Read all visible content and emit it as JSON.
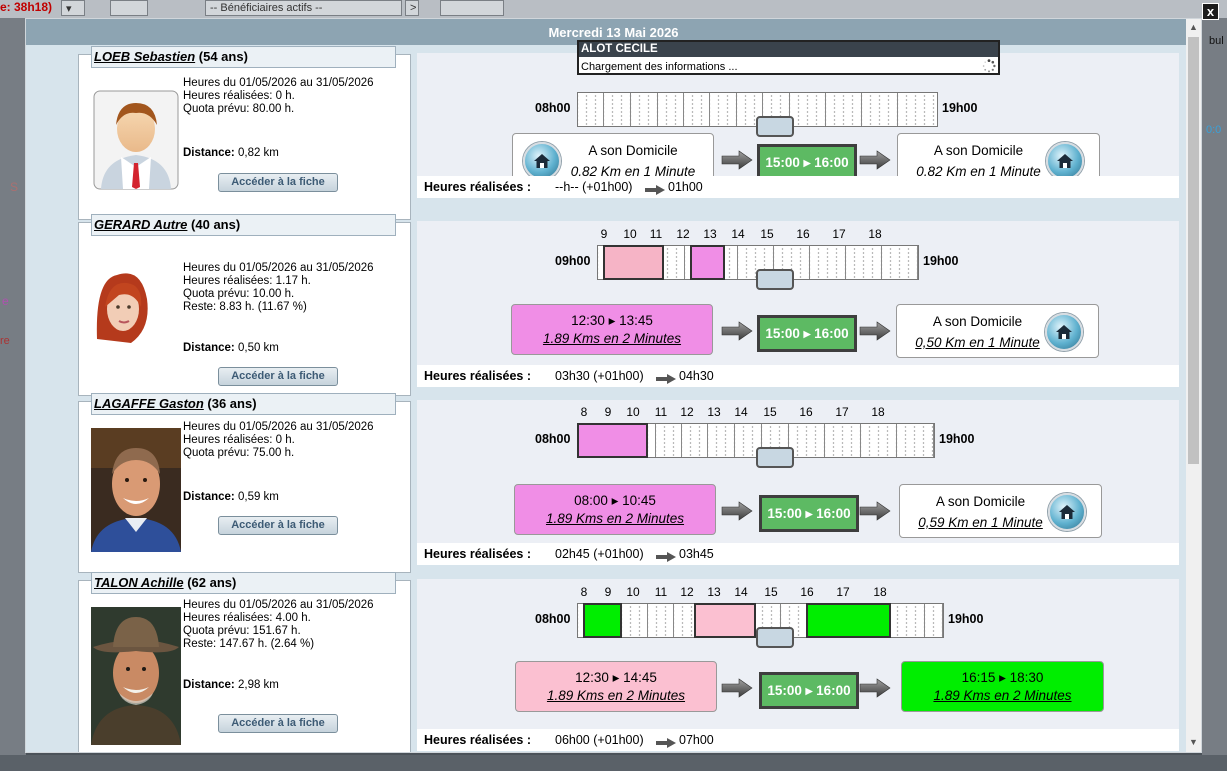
{
  "background": {
    "fragment_left": "e: 38h18)",
    "filter_label": "-- Bénéficiaires actifs --",
    "fragment_right_top": "bul",
    "fragment_right_mid": "0:0",
    "fragment_left_a": "S",
    "fragment_left_b": "e",
    "fragment_left_c": "re"
  },
  "modal": {
    "title": "Mercredi 13 Mai 2026",
    "close_label": "x"
  },
  "popup": {
    "title": "ALOT CECILE",
    "message": "Chargement des informations ..."
  },
  "accent": {
    "appointment": "#5dba63",
    "pink_strong": "#f08ee6",
    "pink_light": "#fbc0d1",
    "green_bright": "#00ee00"
  },
  "beneficiaries": [
    {
      "name": "LOEB Sebastien",
      "age": "(54 ans)",
      "period": "Heures du 01/05/2026 au 31/05/2026",
      "realized": "Heures réalisées: 0 h.",
      "quota": "Quota prévu: 80.00 h.",
      "rest": "",
      "distance_label": "Distance:",
      "distance": "0,82 km",
      "button": "Accéder à la fiche",
      "photo": "avatar-placeholder-icon",
      "start": "08h00",
      "end": "19h00",
      "hour_labels": [],
      "slot": "15:00 ▸ 16:00",
      "before": {
        "type": "home",
        "line1": "A son Domicile",
        "line2": "0,82 Km en 1 Minute"
      },
      "after": {
        "type": "home",
        "line1": "A son Domicile",
        "line2": "0,82 Km en 1 Minute"
      },
      "footer_label": "Heures réalisées :",
      "footer_value": "--h-- (+01h00)",
      "footer_result": "01h00"
    },
    {
      "name": "GERARD Autre",
      "age": "(40 ans)",
      "period": "Heures du 01/05/2026 au 31/05/2026",
      "realized": "Heures réalisées: 1.17 h.",
      "quota": "Quota prévu: 10.00 h.",
      "rest": "Reste: 8.83 h. (11.67 %)",
      "distance_label": "Distance:",
      "distance": "0,50 km",
      "button": "Accéder à la fiche",
      "photo": "woman-red-hair-photo",
      "start": "09h00",
      "end": "19h00",
      "hour_labels": [
        "9",
        "10",
        "11",
        "12",
        "13",
        "14",
        "15",
        "16",
        "17",
        "18"
      ],
      "slot": "15:00 ▸ 16:00",
      "before": {
        "type": "appt",
        "color": "#f08ee6",
        "line1": "12:30 ▸ 13:45",
        "line2": "1.89 Kms en 2 Minutes"
      },
      "after": {
        "type": "home",
        "line1": "A son Domicile",
        "line2": "0,50 Km en 1 Minute"
      },
      "footer_label": "Heures réalisées :",
      "footer_value": "03h30 (+01h00)",
      "footer_result": "04h30"
    },
    {
      "name": "LAGAFFE Gaston",
      "age": "(36 ans)",
      "period": "Heures du 01/05/2026 au 31/05/2026",
      "realized": "Heures réalisées: 0 h.",
      "quota": "Quota prévu: 75.00 h.",
      "rest": "",
      "distance_label": "Distance:",
      "distance": "0,59 km",
      "button": "Accéder à la fiche",
      "photo": "smiling-man-photo",
      "start": "08h00",
      "end": "19h00",
      "hour_labels": [
        "8",
        "9",
        "10",
        "11",
        "12",
        "13",
        "14",
        "15",
        "16",
        "17",
        "18"
      ],
      "slot": "15:00 ▸ 16:00",
      "before": {
        "type": "appt",
        "color": "#f08ee6",
        "line1": "08:00 ▸ 10:45",
        "line2": "1.89 Kms en 2 Minutes"
      },
      "after": {
        "type": "home",
        "line1": "A son Domicile",
        "line2": "0,59 Km en 1 Minute"
      },
      "footer_label": "Heures réalisées :",
      "footer_value": "02h45 (+01h00)",
      "footer_result": "03h45"
    },
    {
      "name": "TALON Achille",
      "age": "(62 ans)",
      "period": "Heures du 01/05/2026 au 31/05/2026",
      "realized": "Heures réalisées: 4.00 h.",
      "quota": "Quota prévu: 151.67 h.",
      "rest": "Reste: 147.67 h. (2.64 %)",
      "distance_label": "Distance:",
      "distance": "2,98 km",
      "button": "Accéder à la fiche",
      "photo": "cowboy-hat-man-photo",
      "start": "08h00",
      "end": "19h00",
      "hour_labels": [
        "8",
        "9",
        "10",
        "11",
        "12",
        "13",
        "14",
        "15",
        "16",
        "17",
        "18"
      ],
      "slot": "15:00 ▸ 16:00",
      "before": {
        "type": "appt",
        "color": "#fbc0d1",
        "line1": "12:30 ▸ 14:45",
        "line2": "1.89 Kms en 2 Minutes"
      },
      "after": {
        "type": "appt",
        "color": "#00ee00",
        "line1": "16:15 ▸ 18:30",
        "line2": "1.89 Kms en 2 Minutes"
      },
      "footer_label": "Heures réalisées :",
      "footer_value": "06h00 (+01h00)",
      "footer_result": "07h00"
    }
  ]
}
